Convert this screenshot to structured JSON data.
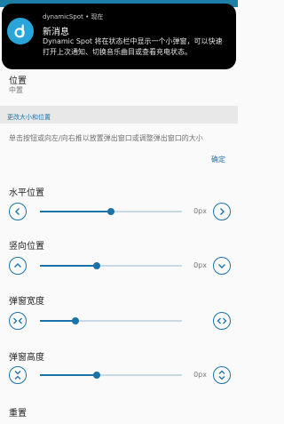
{
  "notification": {
    "app_name": "dynamicSpot",
    "time": "现在",
    "title": "新消息",
    "body": "Dynamic Spot 将在状态栏中显示一个小弹窗，可以快速打开上次通知、切换音乐曲目或查看充电状态。"
  },
  "position_setting": {
    "title": "位置",
    "value": "中置"
  },
  "section": {
    "label": "更改大小和位置"
  },
  "description": "单击按钮或向左/向右推以放置弹出窗口或调整弹出窗口的大小",
  "confirm_label": "确定",
  "controls": [
    {
      "title": "水平位置",
      "value_label": "0px",
      "level": 0.5
    },
    {
      "title": "竖向位置",
      "value_label": "0px",
      "level": 0.4
    },
    {
      "title": "弹窗宽度",
      "value_label": "",
      "level": 0.25
    },
    {
      "title": "弹窗高度",
      "value_label": "0px",
      "level": 0.4
    }
  ],
  "reset_label": "重置",
  "colors": {
    "accent": "#1a73a8",
    "notification_bg": "#000000",
    "app_icon": "#2aa5d8"
  }
}
